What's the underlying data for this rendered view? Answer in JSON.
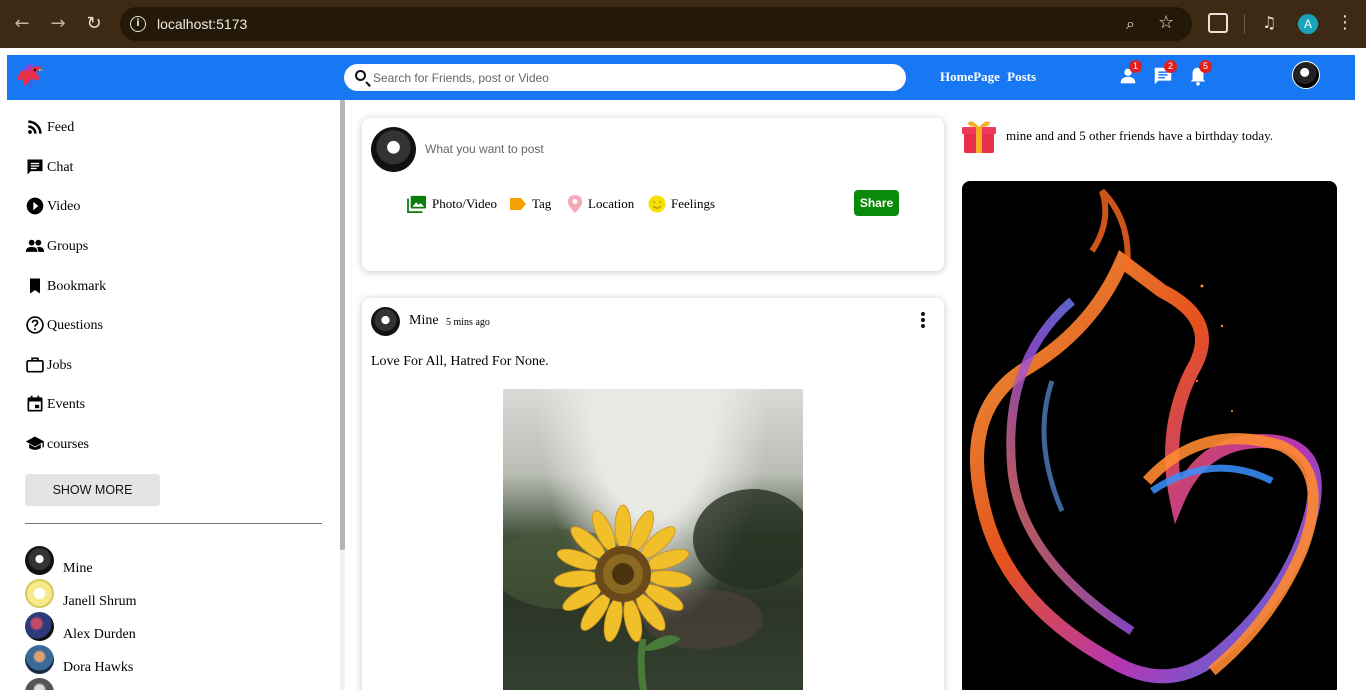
{
  "browser": {
    "url": "localhost:5173",
    "profile_initial": "A",
    "icons": [
      "back-arrow-icon",
      "forward-arrow-icon",
      "reload-icon",
      "info-icon",
      "zoom-icon",
      "star-icon",
      "extensions-icon",
      "media-icon",
      "menu-icon"
    ]
  },
  "topbar": {
    "search_placeholder": "Search for Friends, post or Video",
    "links": {
      "home": "HomePage",
      "posts": "Posts"
    },
    "badges": {
      "friends": "1",
      "messages": "2",
      "notifications": "5"
    },
    "color": "#1877f2"
  },
  "sidebar": {
    "items": [
      {
        "label": "Feed",
        "icon": "rss-feed-icon"
      },
      {
        "label": "Chat",
        "icon": "chat-icon"
      },
      {
        "label": "Video",
        "icon": "play-circle-icon"
      },
      {
        "label": "Groups",
        "icon": "groups-icon"
      },
      {
        "label": "Bookmark",
        "icon": "bookmark-icon"
      },
      {
        "label": "Questions",
        "icon": "help-circle-icon"
      },
      {
        "label": "Jobs",
        "icon": "briefcase-icon"
      },
      {
        "label": "Events",
        "icon": "calendar-icon"
      },
      {
        "label": "courses",
        "icon": "school-icon"
      }
    ],
    "show_more": "SHOW MORE",
    "friends": [
      {
        "name": "Mine"
      },
      {
        "name": "Janell Shrum"
      },
      {
        "name": "Alex Durden"
      },
      {
        "name": "Dora Hawks"
      }
    ]
  },
  "share": {
    "placeholder": "What you want to post",
    "options": [
      {
        "label": "Photo/Video",
        "icon": "photo-library-icon",
        "color": "#0a7d0a"
      },
      {
        "label": "Tag",
        "icon": "label-icon",
        "color": "#f5a200"
      },
      {
        "label": "Location",
        "icon": "location-pin-icon",
        "color": "#f7a8b8"
      },
      {
        "label": "Feelings",
        "icon": "emoji-icon",
        "color": "#f7e000"
      }
    ],
    "button": "Share",
    "button_color": "#0a8a0a"
  },
  "post": {
    "author": "Mine",
    "time": "5 mins ago",
    "text": "Love For All, Hatred For None."
  },
  "right": {
    "birthday_text": "mine and and 5 other friends have a birthday today."
  }
}
